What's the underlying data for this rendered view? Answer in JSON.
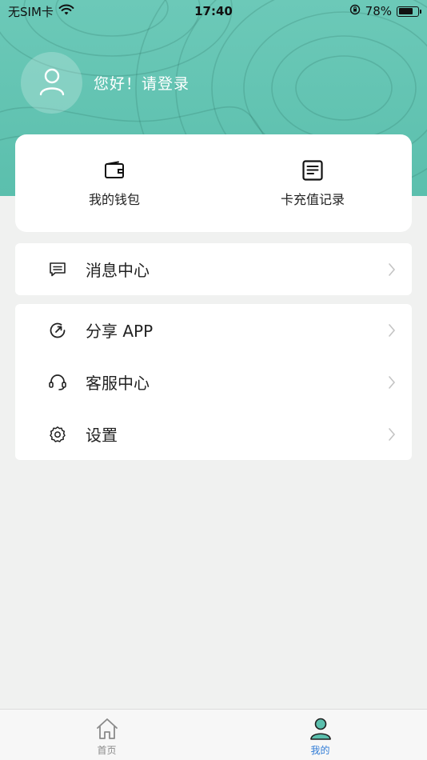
{
  "status_bar": {
    "carrier": "无SIM卡",
    "time": "17:40",
    "battery_percent": "78%",
    "battery_level": 0.78,
    "icons": [
      "wifi-icon",
      "orientation-lock-icon",
      "battery-icon"
    ]
  },
  "header": {
    "greeting": "您好！请登录",
    "avatar_icon": "user-icon",
    "accent_color": "#5bbfad"
  },
  "quick_actions": [
    {
      "label": "我的钱包",
      "icon": "wallet-icon"
    },
    {
      "label": "卡充值记录",
      "icon": "recharge-record-icon"
    }
  ],
  "menu_groups": [
    {
      "items": [
        {
          "label": "消息中心",
          "icon": "message-icon"
        }
      ]
    },
    {
      "items": [
        {
          "label": "分享 APP",
          "icon": "share-icon"
        },
        {
          "label": "客服中心",
          "icon": "headset-icon"
        },
        {
          "label": "设置",
          "icon": "gear-icon"
        }
      ]
    }
  ],
  "tabbar": {
    "tabs": [
      {
        "label": "首页",
        "icon": "home-icon",
        "active": false
      },
      {
        "label": "我的",
        "icon": "profile-icon",
        "active": true
      }
    ],
    "active_color": "#2f7bd6"
  }
}
